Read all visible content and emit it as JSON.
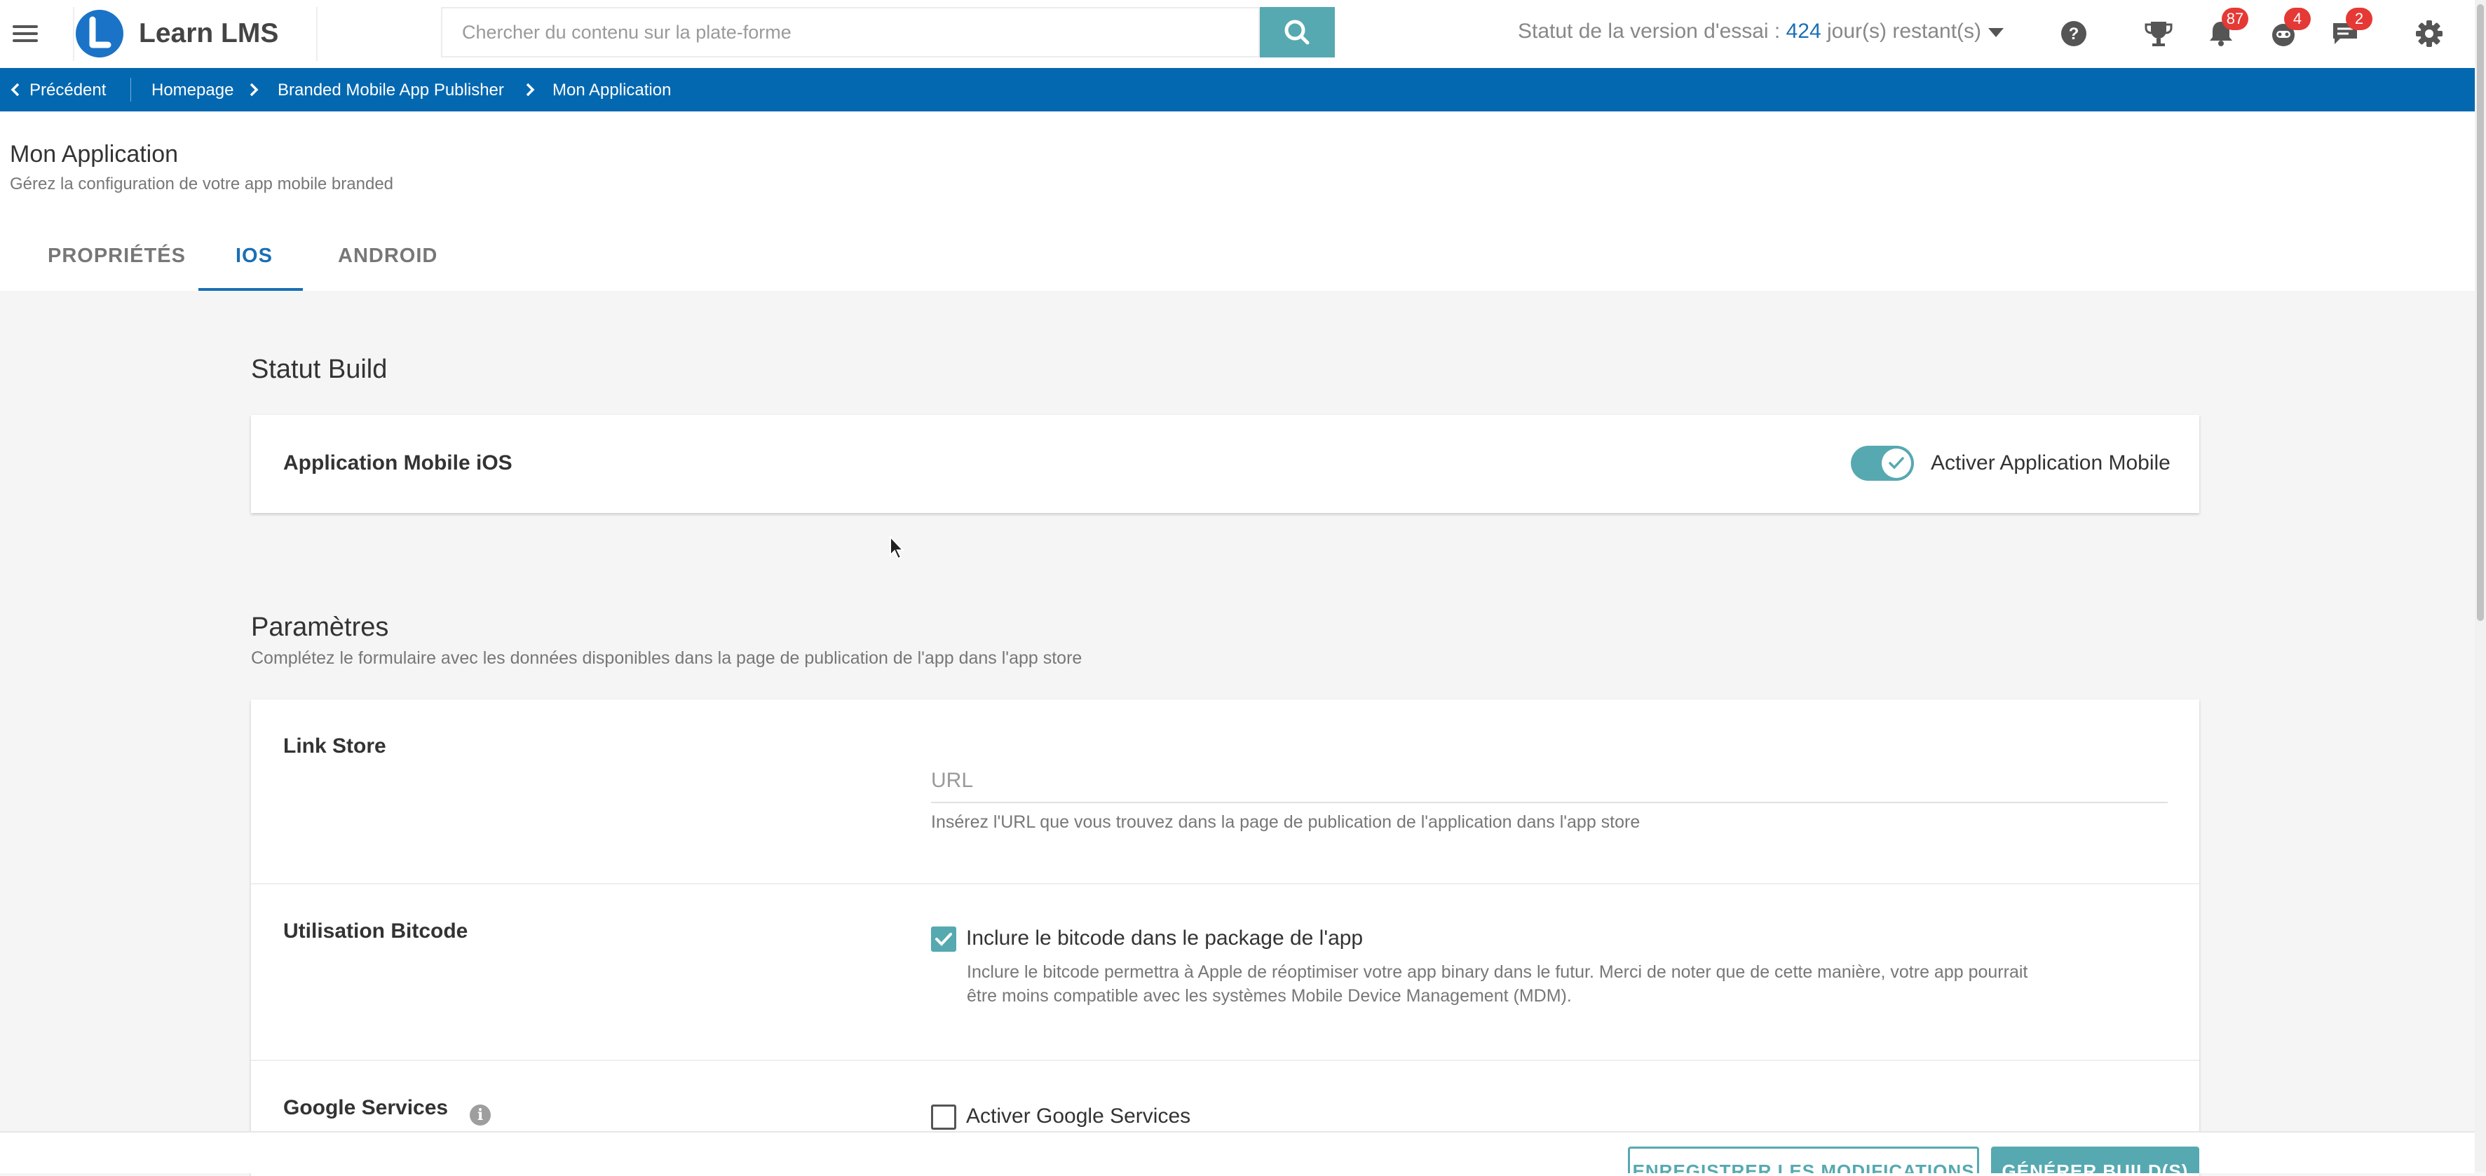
{
  "header": {
    "app_name": "Learn LMS",
    "search_placeholder": "Chercher du contenu sur la plate-forme",
    "trial_prefix": "Statut de la version d'essai : ",
    "trial_days": "424",
    "trial_suffix": " jour(s) restant(s)",
    "notifications_count": "87",
    "robot_count": "4",
    "messages_count": "2"
  },
  "breadcrumb": {
    "back": "Précédent",
    "items": [
      "Homepage",
      "Branded Mobile App Publisher",
      "Mon Application"
    ]
  },
  "page": {
    "title": "Mon Application",
    "subtitle": "Gérez la configuration de votre app mobile branded",
    "tabs": [
      "PROPRIÉTÉS",
      "IOS",
      "ANDROID"
    ],
    "active_tab": "IOS"
  },
  "build_status": {
    "title": "Statut Build",
    "label": "Application Mobile iOS",
    "toggle_label": "Activer Application Mobile",
    "toggle_on": true
  },
  "settings": {
    "title": "Paramètres",
    "subtitle": "Complétez le formulaire avec les données disponibles dans la page de publication de l'app dans l'app store",
    "link_store": {
      "label": "Link Store",
      "placeholder": "URL",
      "hint": "Insérez l'URL que vous trouvez dans la page de publication de l'application dans l'app store"
    },
    "bitcode": {
      "label": "Utilisation Bitcode",
      "checkbox_label": "Inclure le bitcode dans le package de l'app",
      "checked": true,
      "hint_line1": "Inclure le bitcode permettra à Apple de réoptimiser votre app binary dans le futur. Merci de noter que de cette manière, votre app pourrait",
      "hint_line2": "être moins compatible avec les systèmes Mobile Device Management (MDM)."
    },
    "google_services": {
      "label": "Google Services",
      "checkbox_label": "Activer Google Services",
      "checked": false
    }
  },
  "footer": {
    "save_label": "ENREGISTRER LES MODIFICATIONS",
    "build_label": "GÉNÉRER BUILD(S)"
  },
  "colors": {
    "primary_blue": "#0468b1",
    "teal": "#56a9b1",
    "badge_red": "#e53935"
  }
}
